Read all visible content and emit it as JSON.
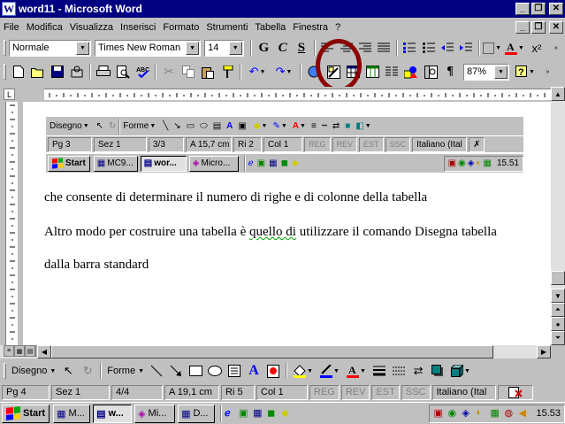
{
  "window": {
    "title": "word11 - Microsoft Word"
  },
  "menu": {
    "items": [
      "File",
      "Modifica",
      "Visualizza",
      "Inserisci",
      "Formato",
      "Strumenti",
      "Tabella",
      "Finestra",
      "?"
    ]
  },
  "formatting": {
    "style": "Normale",
    "font": "Times New Roman",
    "size": "14",
    "bold": "G",
    "italic": "C",
    "underline": "S"
  },
  "standard": {
    "zoom": "87%"
  },
  "embedded": {
    "drawbar": {
      "draw_label": "Disegno",
      "autoshapes_label": "Forme"
    },
    "status": {
      "page": "Pg 3",
      "section": "Sez 1",
      "pages": "3/3",
      "at": "A 15,7 cm",
      "line": "Ri 2",
      "col": "Col 1",
      "rec": "REG",
      "rev": "REV",
      "ext": "EST",
      "ovr": "SSC",
      "lang": "Italiano (Ital"
    },
    "taskbar": {
      "start": "Start",
      "tasks": [
        "MC9...",
        "wor...",
        "Micro..."
      ],
      "clock": "15.51"
    }
  },
  "document": {
    "paragraphs": [
      "che consente di determinare il numero di righe e di colonne della tabella",
      "Altro modo per costruire una tabella è quello di utilizzare il comando Disegna tabella",
      "dalla barra standard"
    ]
  },
  "drawbar": {
    "draw_label": "Disegno",
    "autoshapes_label": "Forme"
  },
  "status": {
    "page": "Pg 4",
    "section": "Sez 1",
    "pages": "4/4",
    "at": "A 19,1 cm",
    "line": "Ri 5",
    "col": "Col 1",
    "rec": "REG",
    "rev": "REV",
    "ext": "EST",
    "ovr": "SSC",
    "lang": "Italiano (Ital"
  },
  "taskbar": {
    "start": "Start",
    "tasks": [
      "M...",
      "w...",
      "Mi...",
      "D..."
    ],
    "clock": "15.53"
  },
  "colors": {
    "titlebar": "#000080",
    "highlight_circle": "#8b0000"
  }
}
